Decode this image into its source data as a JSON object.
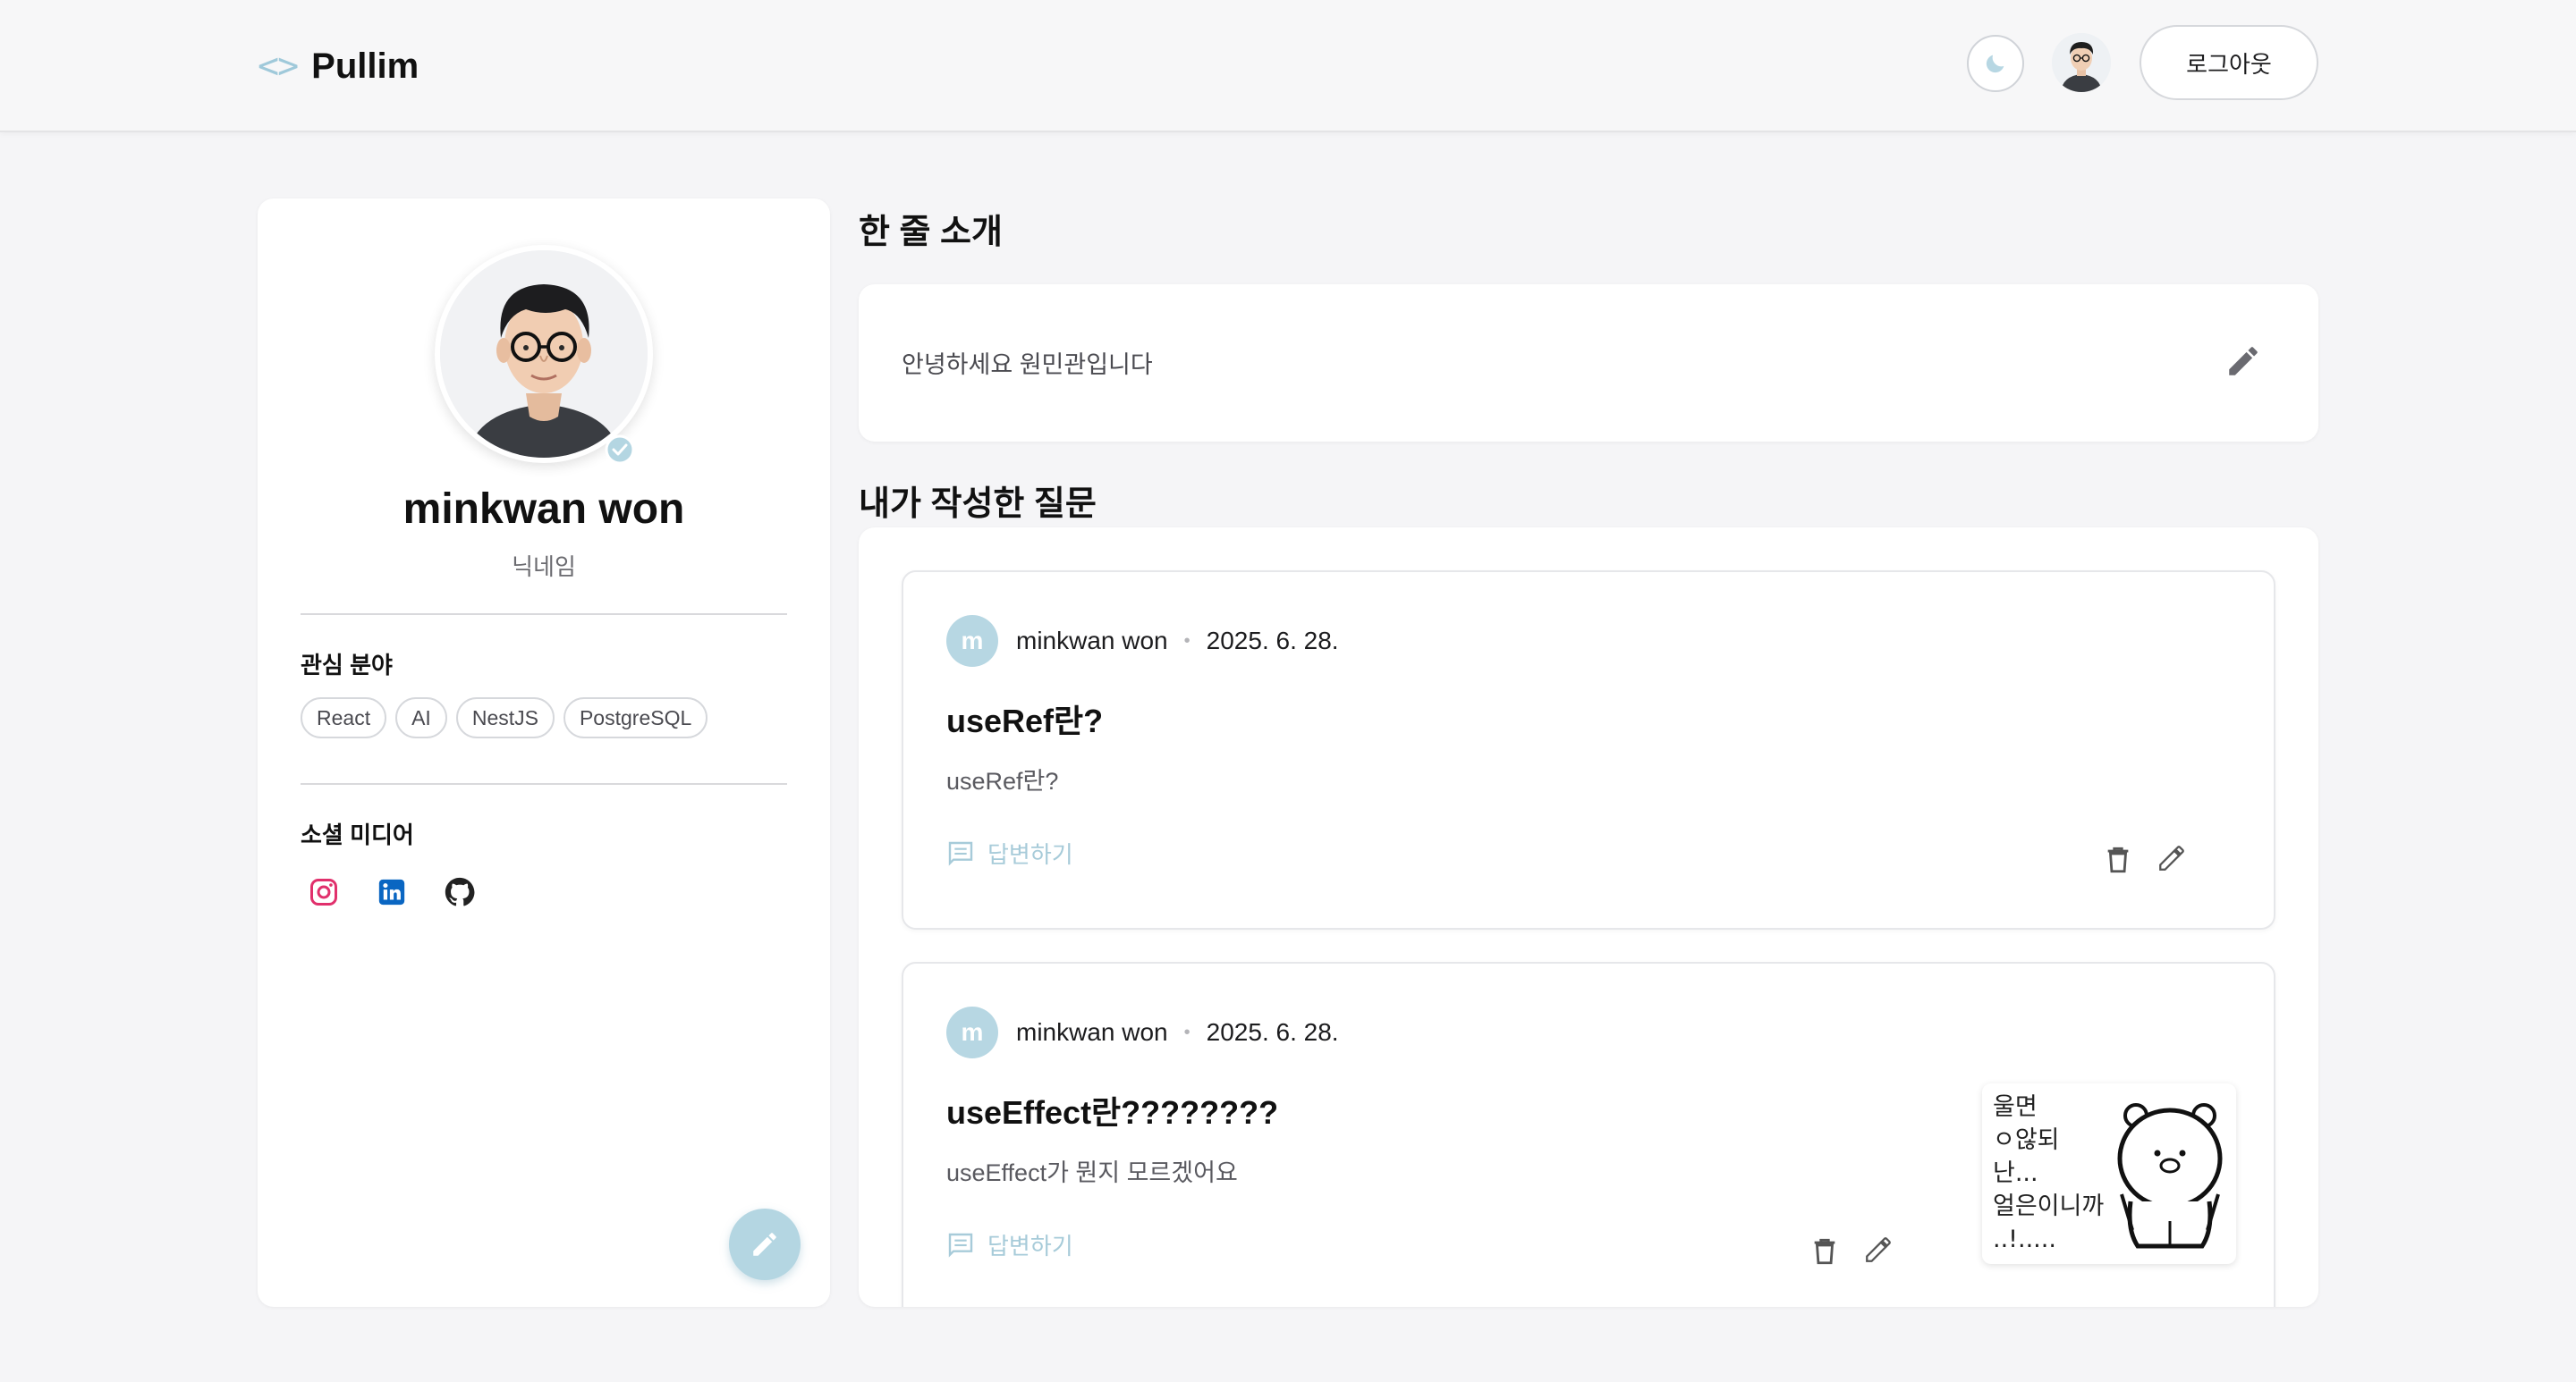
{
  "header": {
    "brand_code_icon": "code-brackets-icon",
    "brand_name": "Pullim",
    "theme_toggle_icon": "moon-icon",
    "logout_label": "로그아웃"
  },
  "profile": {
    "name": "minkwan won",
    "nickname": "닉네임",
    "interests_label": "관심 분야",
    "interests": [
      "React",
      "AI",
      "NestJS",
      "PostgreSQL"
    ],
    "social_label": "소셜 미디어",
    "socials": [
      {
        "name": "instagram-icon",
        "color": "#e1306c"
      },
      {
        "name": "linkedin-icon",
        "color": "#0a66c2"
      },
      {
        "name": "github-icon",
        "color": "#222222"
      }
    ],
    "edit_fab_icon": "pencil-icon"
  },
  "intro": {
    "heading": "한 줄 소개",
    "text": "안녕하세요 원민관입니다"
  },
  "questions": {
    "heading": "내가 작성한 질문",
    "items": [
      {
        "avatar_initial": "m",
        "author": "minkwan won",
        "date": "2025. 6. 28.",
        "title": "useRef란?",
        "body": "useRef란?",
        "answer_label": "답변하기"
      },
      {
        "avatar_initial": "m",
        "author": "minkwan won",
        "date": "2025. 6. 28.",
        "title": "useEffect란????????",
        "body": "useEffect가 뭔지 모르겠어요",
        "answer_label": "답변하기",
        "thumbnail_text": "울면\nㅇ않되\n난...\n얼은이니까\n..!....."
      }
    ]
  },
  "colors": {
    "accent": "#b4d6e2",
    "accent_text": "#a7cbd9",
    "background": "#f5f5f7"
  }
}
